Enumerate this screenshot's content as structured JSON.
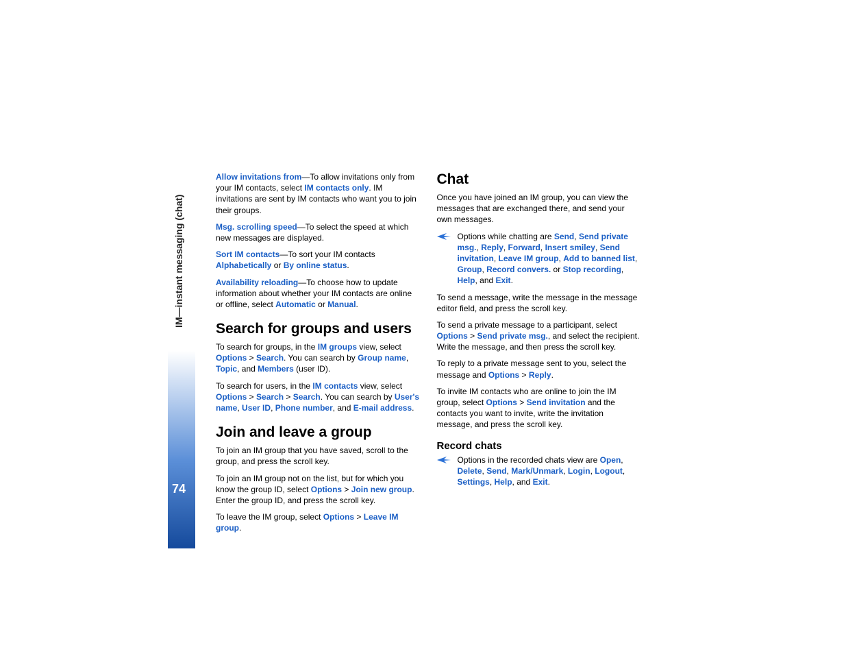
{
  "sidebar": {
    "label": "IM—instant messaging (chat)",
    "page_number": "74"
  },
  "left_column": {
    "allow_invitations": {
      "label": "Allow invitations from",
      "text1": "—To allow invitations only from your IM contacts, select ",
      "option": "IM contacts only",
      "text2": ". IM invitations are sent by IM contacts who want you to join their groups."
    },
    "msg_scrolling": {
      "label": "Msg. scrolling speed",
      "text": "—To select the speed at which new messages are displayed."
    },
    "sort_contacts": {
      "label": "Sort IM contacts",
      "text1": "—To sort your IM contacts ",
      "option1": "Alphabetically",
      "text2": " or ",
      "option2": "By online status",
      "text3": "."
    },
    "availability": {
      "label": "Availability reloading",
      "text1": "—To choose how to update information about whether your IM contacts are online or offline, select ",
      "option1": "Automatic",
      "text2": " or ",
      "option2": "Manual",
      "text3": "."
    },
    "search_heading": "Search for groups and users",
    "search_groups": {
      "text1": "To search for groups, in the ",
      "im_groups": "IM groups",
      "text2": " view, select ",
      "options": "Options",
      "gt": " > ",
      "search": "Search",
      "text3": ". You can search by ",
      "group_name": "Group name",
      "comma": ", ",
      "topic": "Topic",
      "and": ", and ",
      "members": "Members",
      "text4": " (user ID)."
    },
    "search_users": {
      "text1": "To search for users, in the ",
      "im_contacts": "IM contacts",
      "text2": " view, select ",
      "options": "Options",
      "gt": " > ",
      "search1": "Search",
      "search2": "Search",
      "text3": ". You can search by ",
      "users_name": "User's name",
      "comma": ", ",
      "user_id": "User ID",
      "phone": "Phone number",
      "and": ", and ",
      "email": "E-mail address",
      "text4": "."
    },
    "join_heading": "Join and leave a group",
    "join_saved": "To join an IM group that you have saved, scroll to the group, and press the scroll key.",
    "join_not_on_list": {
      "text1": "To join an IM group not on the list, but for which you know the group ID, select ",
      "options": "Options",
      "gt": " > ",
      "join_new": "Join new group",
      "text2": ". Enter the group ID, and press the scroll key."
    },
    "leave_group": {
      "text1": "To leave the IM group, select ",
      "options": "Options",
      "gt": " > ",
      "leave": "Leave IM group",
      "text2": "."
    }
  },
  "right_column": {
    "chat_heading": "Chat",
    "chat_intro": "Once you have joined an IM group, you can view the messages that are exchanged there, and send your own messages.",
    "chat_options": {
      "intro": "Options while chatting are ",
      "send": "Send",
      "send_private": "Send private msg.",
      "reply": "Reply",
      "forward": "Forward",
      "insert_smiley": "Insert smiley",
      "send_invitation": "Send invitation",
      "leave_im": "Leave IM group",
      "add_banned": "Add to banned list",
      "group": "Group",
      "record_convers": "Record convers.",
      "or": " or ",
      "stop_recording": "Stop recording",
      "help": "Help",
      "and": ", and ",
      "exit": "Exit",
      "period": ".",
      "comma": ", "
    },
    "send_message": "To send a message, write the message in the message editor field, and press the scroll key.",
    "send_private_msg": {
      "text1": "To send a private message to a participant, select ",
      "options": "Options",
      "gt": " > ",
      "send_private": "Send private msg.",
      "text2": ", and select the recipient. Write the message, and then press the scroll key."
    },
    "reply_private": {
      "text1": "To reply to a private message sent to you, select the message and ",
      "options": "Options",
      "gt": " > ",
      "reply": "Reply",
      "text2": "."
    },
    "invite": {
      "text1": "To invite IM contacts who are online to join the IM group, select ",
      "options": "Options",
      "gt": " > ",
      "send_invitation": "Send invitation",
      "text2": " and the contacts you want to invite, write the invitation message, and press the scroll key."
    },
    "record_heading": "Record chats",
    "record_options": {
      "intro": "Options in the recorded chats view are ",
      "open": "Open",
      "delete": "Delete",
      "send": "Send",
      "mark": "Mark/Unmark",
      "login": "Login",
      "logout": "Logout",
      "settings": "Settings",
      "help": "Help",
      "and": ", and ",
      "exit": "Exit",
      "period": ".",
      "comma": ", "
    }
  }
}
